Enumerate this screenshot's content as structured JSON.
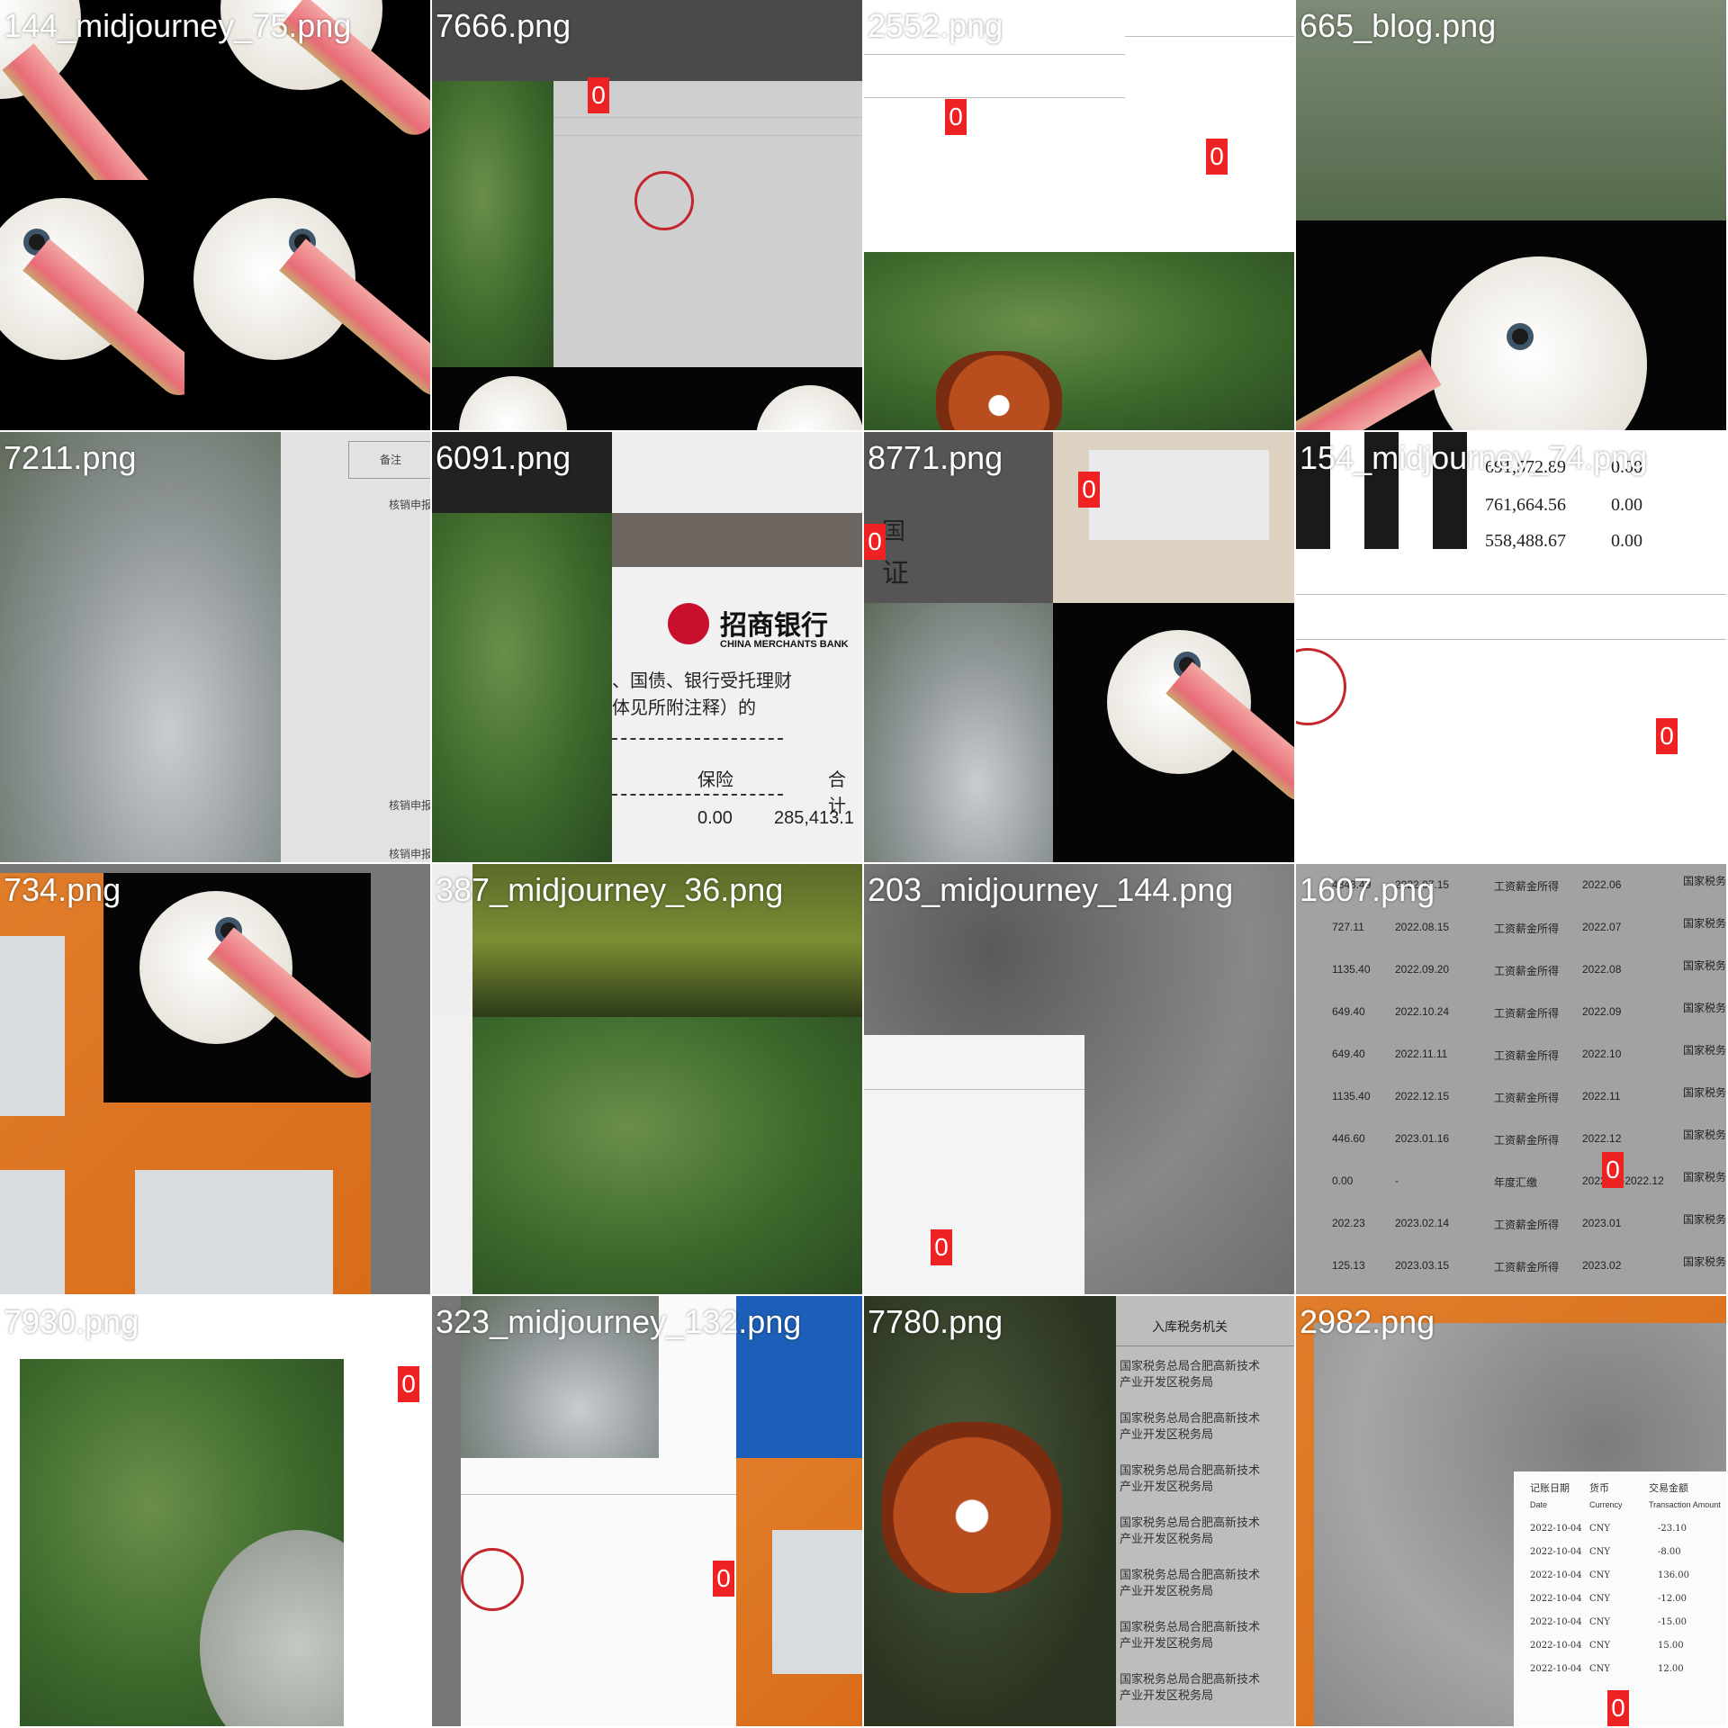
{
  "tiles": [
    {
      "label": "144_midjourney_75.png"
    },
    {
      "label": "7666.png",
      "boxes": [
        "0"
      ]
    },
    {
      "label": "2552.png",
      "boxes": [
        "0",
        "0"
      ]
    },
    {
      "label": "665_blog.png"
    },
    {
      "label": "7211.png",
      "doc_snippets": [
        "备注",
        "核销申报",
        "核销申报",
        "核销申报"
      ]
    },
    {
      "label": "6091.png",
      "bank": "招商银行",
      "bank_en": "CHINA MERCHANTS BANK",
      "line1": "、国债、银行受托理财",
      "line2": "体见所附注释）的",
      "insurance": "保险",
      "total": "合计",
      "v1": "0.00",
      "v2": "285,413.1"
    },
    {
      "label": "8771.png",
      "boxes": [
        "0",
        "0"
      ],
      "doc_chars": [
        "国",
        "证"
      ]
    },
    {
      "label": "154_midjourney_74.png",
      "boxes": [
        "0"
      ],
      "nums": [
        "691,572.89",
        "761,664.56",
        "558,488.67"
      ],
      "zeros": [
        "0.00",
        "0.00",
        "0.00"
      ]
    },
    {
      "label": "734.png"
    },
    {
      "label": "387_midjourney_36.png"
    },
    {
      "label": "203_midjourney_144.png",
      "boxes": [
        "0"
      ]
    },
    {
      "label": "1607.png",
      "boxes": [
        "0"
      ],
      "rows": [
        {
          "amount": "4343.49",
          "date": "2022.07.15",
          "type": "工资薪金所得",
          "period": "2022.06"
        },
        {
          "amount": "727.11",
          "date": "2022.08.15",
          "type": "工资薪金所得",
          "period": "2022.07"
        },
        {
          "amount": "1135.40",
          "date": "2022.09.20",
          "type": "工资薪金所得",
          "period": "2022.08"
        },
        {
          "amount": "649.40",
          "date": "2022.10.24",
          "type": "工资薪金所得",
          "period": "2022.09"
        },
        {
          "amount": "649.40",
          "date": "2022.11.11",
          "type": "工资薪金所得",
          "period": "2022.10"
        },
        {
          "amount": "1135.40",
          "date": "2022.12.15",
          "type": "工资薪金所得",
          "period": "2022.11"
        },
        {
          "amount": "446.60",
          "date": "2023.01.16",
          "type": "工资薪金所得",
          "period": "2022.12"
        },
        {
          "amount": "0.00",
          "date": "-",
          "type": "年度汇缴",
          "period": "2022.01-2022.12"
        },
        {
          "amount": "202.23",
          "date": "2023.02.14",
          "type": "工资薪金所得",
          "period": "2023.01"
        },
        {
          "amount": "125.13",
          "date": "2023.03.15",
          "type": "工资薪金所得",
          "period": "2023.02"
        }
      ],
      "authority": "国家税务总局合肥高新技术产业开发区税务局"
    },
    {
      "label": "7930.png",
      "boxes": [
        "0"
      ]
    },
    {
      "label": "323_midjourney_132.png",
      "boxes": [
        "0"
      ]
    },
    {
      "label": "7780.png",
      "header": "入库税务机关",
      "authority": "国家税务总局合肥高新技术产业开发区税务局"
    },
    {
      "label": "2982.png",
      "boxes": [
        "0"
      ],
      "cols": [
        "记账日期",
        "货币",
        "交易金额"
      ],
      "cols_en": [
        "Date",
        "Currency",
        "Transaction Amount"
      ],
      "rows": [
        {
          "date": "2022-10-04",
          "cur": "CNY",
          "amt": "-23.10"
        },
        {
          "date": "2022-10-04",
          "cur": "CNY",
          "amt": "-8.00"
        },
        {
          "date": "2022-10-04",
          "cur": "CNY",
          "amt": "136.00"
        },
        {
          "date": "2022-10-04",
          "cur": "CNY",
          "amt": "-12.00"
        },
        {
          "date": "2022-10-04",
          "cur": "CNY",
          "amt": "-15.00"
        },
        {
          "date": "2022-10-04",
          "cur": "CNY",
          "amt": "15.00"
        },
        {
          "date": "2022-10-04",
          "cur": "CNY",
          "amt": "12.00"
        }
      ]
    }
  ]
}
